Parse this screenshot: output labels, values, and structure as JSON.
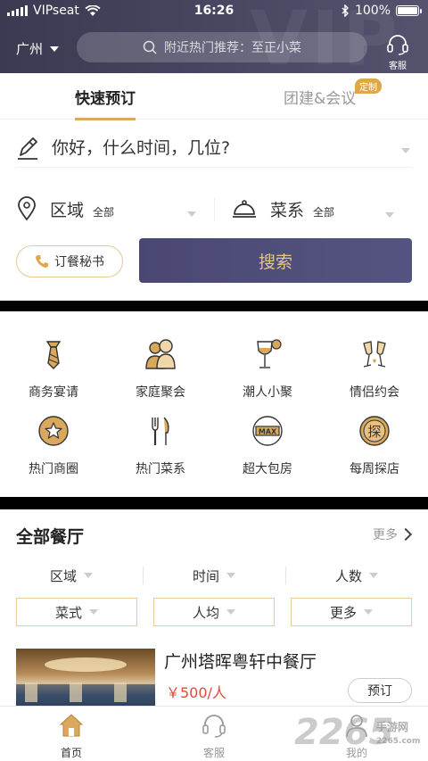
{
  "status_bar": {
    "carrier": "VIPseat",
    "time": "16:26",
    "battery": "100%"
  },
  "header": {
    "city": "广州",
    "search_placeholder": "附近热门推荐：至正小菜",
    "service_label": "客服"
  },
  "booking": {
    "tabs": [
      {
        "label": "快速预订",
        "active": true
      },
      {
        "label": "团建&会议",
        "active": false,
        "badge": "定制"
      }
    ],
    "time_prompt": "你好，什么时间，几位?",
    "area": {
      "label": "区域",
      "value": "全部"
    },
    "cuisine": {
      "label": "菜系",
      "value": "全部"
    },
    "secretary_label": "订餐秘书",
    "search_label": "搜索"
  },
  "categories": [
    {
      "label": "商务宴请",
      "icon": "tie-icon"
    },
    {
      "label": "家庭聚会",
      "icon": "family-icon"
    },
    {
      "label": "潮人小聚",
      "icon": "wine-glass-icon"
    },
    {
      "label": "情侣约会",
      "icon": "champagne-icon"
    },
    {
      "label": "热门商圈",
      "icon": "star-badge-icon"
    },
    {
      "label": "热门菜系",
      "icon": "fork-knife-icon"
    },
    {
      "label": "超大包房",
      "icon": "max-room-icon"
    },
    {
      "label": "每周探店",
      "icon": "explore-icon",
      "glyph": "探"
    }
  ],
  "restaurants": {
    "title": "全部餐厅",
    "more_label": "更多",
    "filters_row1": [
      "区域",
      "时间",
      "人数"
    ],
    "filters_row2": [
      "菜式",
      "人均",
      "更多"
    ],
    "items": [
      {
        "name": "广州塔晖粤轩中餐厅",
        "price": "￥500/人",
        "reserve_label": "预订"
      }
    ]
  },
  "bottom_nav": [
    {
      "label": "首页",
      "icon": "home-icon",
      "active": true
    },
    {
      "label": "客服",
      "icon": "headset-icon",
      "active": false
    },
    {
      "label": "我的",
      "icon": "profile-icon",
      "active": false
    }
  ],
  "watermark": {
    "brand": "2265",
    "sub": "手游网",
    "url": "2265.com"
  },
  "colors": {
    "accent_gold": "#d9a85c",
    "header_bg": "#3a3a52",
    "search_button": "#4a4873",
    "price_red": "#e04a3a"
  }
}
